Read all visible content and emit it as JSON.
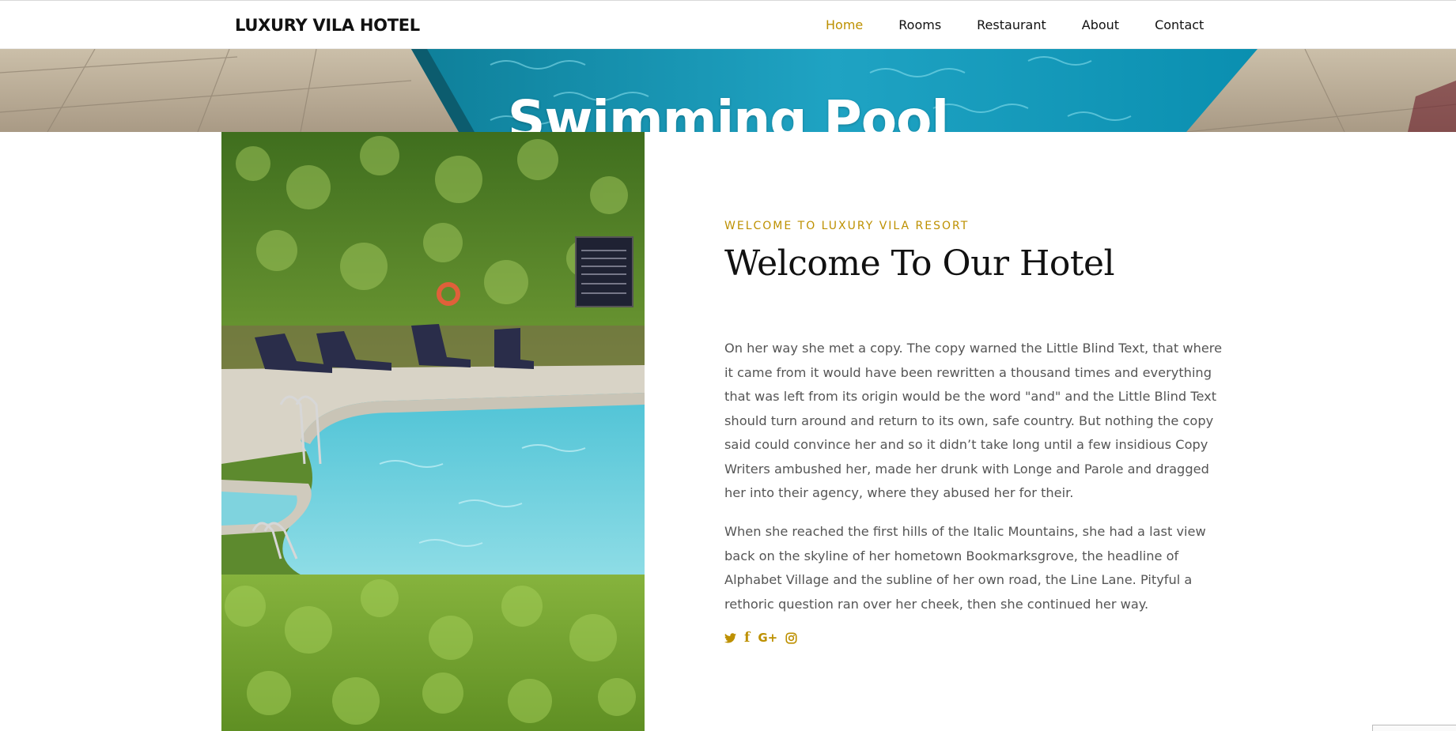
{
  "navbar": {
    "brand": "LUXURY VILA HOTEL",
    "items": [
      {
        "label": "Home",
        "active": true
      },
      {
        "label": "Rooms",
        "active": false
      },
      {
        "label": "Restaurant",
        "active": false
      },
      {
        "label": "About",
        "active": false
      },
      {
        "label": "Contact",
        "active": false
      }
    ]
  },
  "hero": {
    "title": "Swimming Pool"
  },
  "about": {
    "subheading": "WELCOME TO LUXURY VILA RESORT",
    "heading": "Welcome To Our Hotel",
    "paragraphs": [
      "On her way she met a copy. The copy warned the Little Blind Text, that where it came from it would have been rewritten a thousand times and everything that was left from its origin would be the word \"and\" and the Little Blind Text should turn around and return to its own, safe country. But nothing the copy said could convince her and so it didn’t take long until a few insidious Copy Writers ambushed her, made her drunk with Longe and Parole and dragged her into their agency, where they abused her for their.",
      "When she reached the first hills of the Italic Mountains, she had a last view back on the skyline of her hometown Bookmarksgrove, the headline of Alphabet Village and the subline of her own road, the Line Lane. Pityful a rethoric question ran over her cheek, then she continued her way."
    ],
    "social_icons": [
      "twitter-icon",
      "facebook-icon",
      "google-plus-icon",
      "instagram-icon"
    ],
    "social_glyphs": {
      "facebook": "f",
      "google_plus": "G+"
    }
  },
  "colors": {
    "accent": "#bd9000",
    "text": "#555555",
    "heading": "#111111"
  }
}
